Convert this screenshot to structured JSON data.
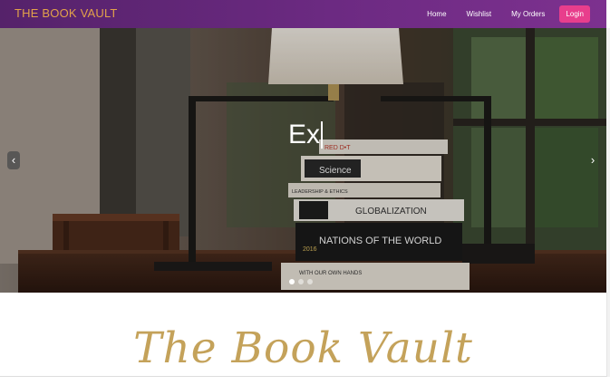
{
  "navbar": {
    "brand": "THE BOOK VAULT",
    "links": [
      "Home",
      "Wishlist",
      "My Orders"
    ],
    "login_label": "Login"
  },
  "carousel": {
    "caption": "Ex",
    "prev_icon": "‹",
    "next_icon": "›",
    "slide_count": 3,
    "active_slide": 1,
    "book_spines": [
      {
        "label": "RED D•T"
      },
      {
        "label": "Science"
      },
      {
        "label": "LEADERSHIP & ETHICS"
      },
      {
        "label": "GLOBALIZATION"
      },
      {
        "label": "NATIONS OF THE WORLD"
      },
      {
        "label": "2016"
      },
      {
        "label": "WITH OUR OWN HANDS"
      }
    ]
  },
  "main": {
    "heading": "The Book Vault"
  },
  "colors": {
    "navbar_start": "#55226a",
    "navbar_end": "#7d318f",
    "brand": "#e2a24a",
    "login": "#e83e8c",
    "heading": "#c4a25a"
  }
}
